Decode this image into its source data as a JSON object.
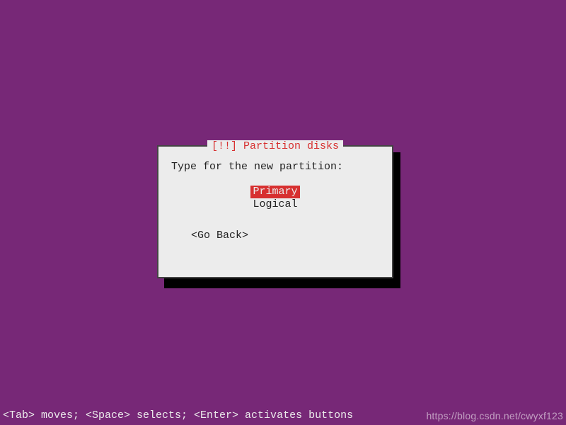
{
  "dialog": {
    "title": "[!!] Partition disks",
    "prompt": "Type for the new partition:",
    "options": {
      "primary": "Primary",
      "logical": "Logical"
    },
    "go_back": "<Go Back>"
  },
  "statusbar": {
    "hint": "<Tab> moves; <Space> selects; <Enter> activates buttons"
  },
  "watermark": "https://blog.csdn.net/cwyxf123"
}
